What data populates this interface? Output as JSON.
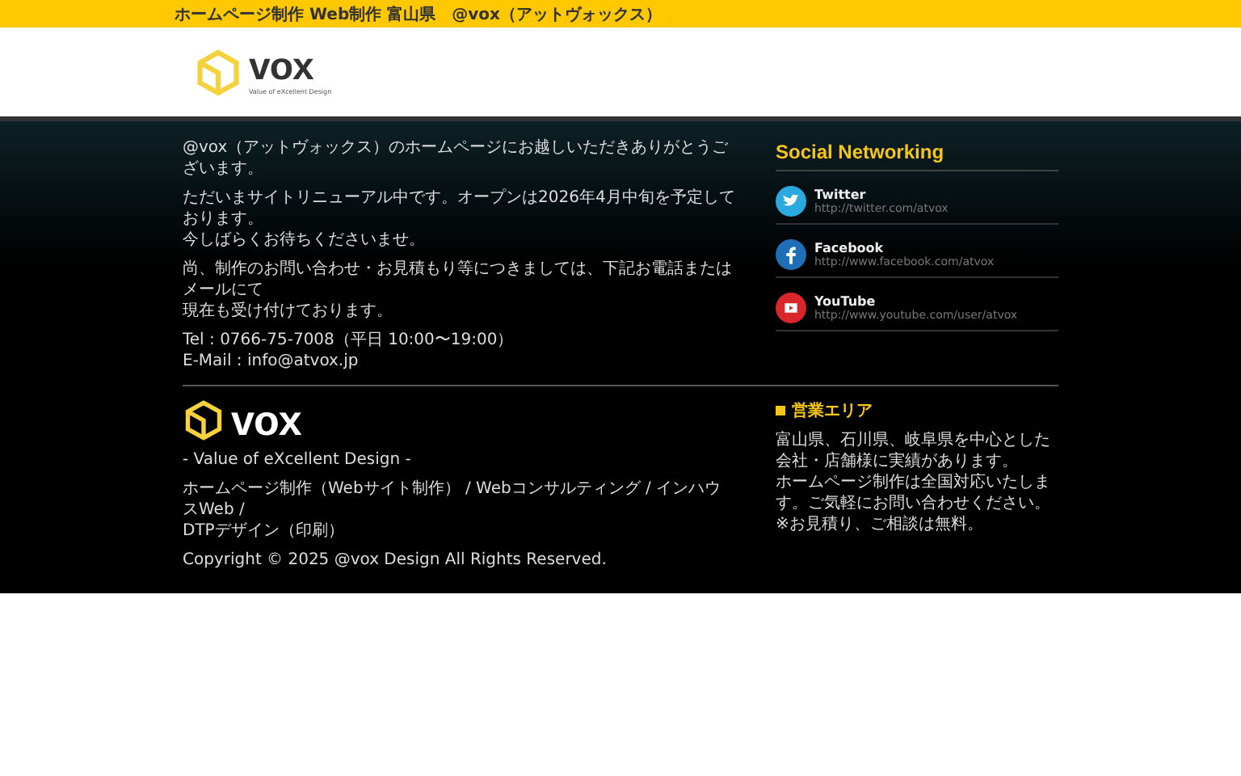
{
  "top_bar": {
    "title": "ホームページ制作 Web制作 富山県　@vox（アットヴォックス）"
  },
  "header": {
    "logo": {
      "name": "vox",
      "tagline": "Value of eXcellent Design"
    }
  },
  "intro": {
    "paragraphs": [
      [
        "@vox（アットヴォックス）のホームページにお越しいただきありがとうございます。"
      ],
      [
        "ただいまサイトリニューアル中です。オープンは2026年4月中旬を予定しております。",
        "今しばらくお待ちくださいませ。"
      ],
      [
        "尚、制作のお問い合わせ・お見積もり等につきましては、下記お電話またはメールにて",
        "現在も受け付けております。"
      ],
      [
        "Tel : 0766-75-7008（平日 10:00〜19:00）",
        "E-Mail : info@atvox.jp"
      ]
    ]
  },
  "social": {
    "title": "Social Networking",
    "items": [
      {
        "kind": "twitter",
        "name": "Twitter",
        "url": "http://twitter.com/atvox"
      },
      {
        "kind": "facebook",
        "name": "Facebook",
        "url": "http://www.facebook.com/atvox"
      },
      {
        "kind": "youtube",
        "name": "YouTube",
        "url": "http://www.youtube.com/user/atvox"
      }
    ]
  },
  "footer": {
    "logo": {
      "name": "vox"
    },
    "tagline": "- Value of eXcellent Design -",
    "services": [
      "ホームページ制作（Webサイト制作） / Webコンサルティング / インハウスWeb /",
      "DTPデザイン（印刷）"
    ],
    "copyright": "Copyright © 2025 @vox Design All Rights Reserved."
  },
  "area": {
    "title": "営業エリア",
    "lines": [
      "富山県、石川県、岐阜県を中心とした会社・店舗様に実績があります。",
      "ホームページ制作は全国対応いたします。ご気軽にお問い合わせください。",
      "※お見積り、ご相談は無料。"
    ]
  }
}
